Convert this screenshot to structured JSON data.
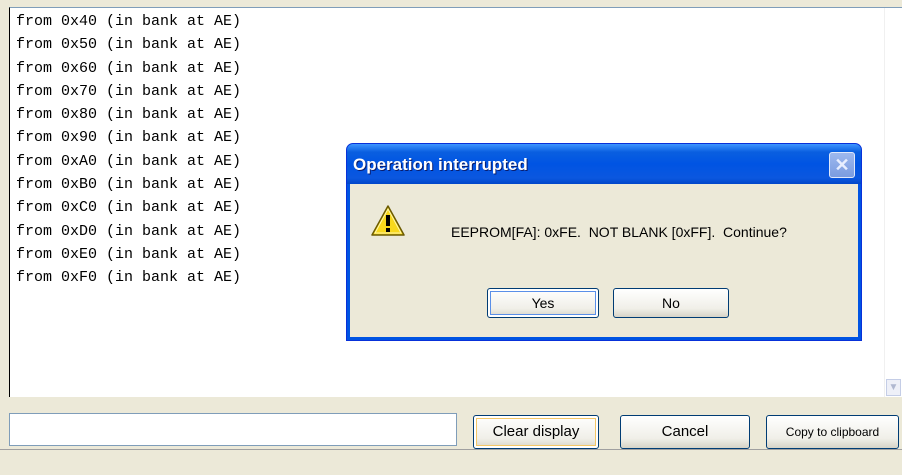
{
  "log": {
    "lines": [
      "from 0x40 (in bank at AE)",
      "from 0x50 (in bank at AE)",
      "from 0x60 (in bank at AE)",
      "from 0x70 (in bank at AE)",
      "from 0x80 (in bank at AE)",
      "from 0x90 (in bank at AE)",
      "from 0xA0 (in bank at AE)",
      "from 0xB0 (in bank at AE)",
      "from 0xC0 (in bank at AE)",
      "from 0xD0 (in bank at AE)",
      "from 0xE0 (in bank at AE)",
      "from 0xF0 (in bank at AE)"
    ]
  },
  "toolbar": {
    "input_value": "",
    "clear_label": "Clear display",
    "cancel_label": "Cancel",
    "copy_label": "Copy to clipboard"
  },
  "dialog": {
    "title": "Operation interrupted",
    "close_glyph": "✕",
    "message": "EEPROM[FA]: 0xFE.  NOT BLANK [0xFF].  Continue?",
    "yes_label": "Yes",
    "no_label": "No",
    "icon": "warning-icon"
  },
  "colors": {
    "titlebar": "#0054e3",
    "dialog_bg": "#ece9d8",
    "warning_fill": "#f8d81c"
  }
}
